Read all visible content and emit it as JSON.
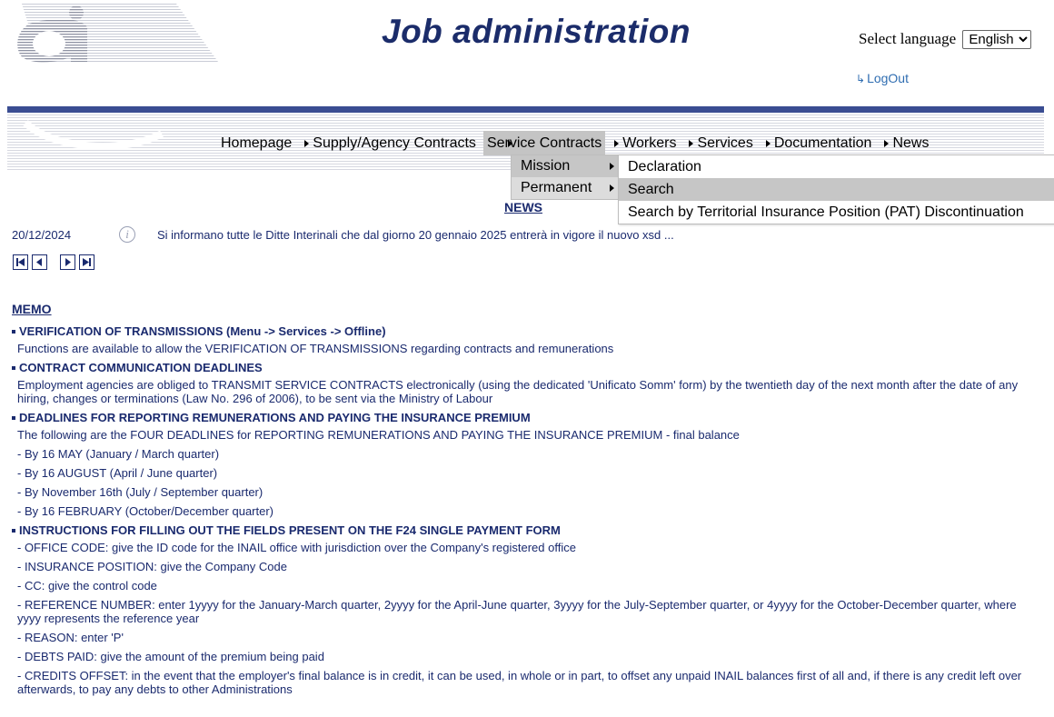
{
  "header": {
    "title": "Job administration",
    "language_label": "Select language",
    "language_selected": "English",
    "logout": "LogOut"
  },
  "menu": {
    "items": [
      {
        "label": "Homepage"
      },
      {
        "label": "Supply/Agency Contracts"
      },
      {
        "label": "Service Contracts"
      },
      {
        "label": "Workers"
      },
      {
        "label": "Services"
      },
      {
        "label": "Documentation"
      },
      {
        "label": "News"
      }
    ],
    "service_contracts_submenu": [
      "Mission",
      "Permanent"
    ],
    "mission_submenu": [
      "Declaration",
      "Search",
      "Search by Territorial Insurance Position (PAT) Discontinuation"
    ]
  },
  "news": {
    "title": "NEWS",
    "date": "20/12/2024",
    "text": "Si informano tutte le Ditte Interinali che dal giorno 20 gennaio 2025 entrerà in vigore il nuovo xsd ..."
  },
  "memo": {
    "title": "MEMO",
    "sections": [
      {
        "heading": "VERIFICATION OF TRANSMISSIONS (Menu -> Services -> Offline)",
        "lines": [
          "Functions are available to allow the VERIFICATION OF TRANSMISSIONS regarding contracts and remunerations"
        ]
      },
      {
        "heading": "CONTRACT COMMUNICATION DEADLINES",
        "lines": [
          "Employment agencies are obliged to TRANSMIT SERVICE CONTRACTS electronically (using the dedicated 'Unificato Somm' form) by the twentieth day of the next month after the date of any hiring, changes or terminations (Law No. 296 of 2006), to be sent via the Ministry of Labour"
        ]
      },
      {
        "heading": "DEADLINES FOR REPORTING REMUNERATIONS AND PAYING THE INSURANCE PREMIUM",
        "lines": [
          "The following are the FOUR DEADLINES for REPORTING REMUNERATIONS AND PAYING THE INSURANCE PREMIUM - final balance",
          "- By 16 MAY (January / March quarter)",
          "- By 16 AUGUST (April / June quarter)",
          "- By November 16th (July / September quarter)",
          "- By 16 FEBRUARY (October/December quarter)"
        ]
      },
      {
        "heading": "INSTRUCTIONS FOR FILLING OUT THE FIELDS PRESENT ON THE F24 SINGLE PAYMENT FORM",
        "lines": [
          "- OFFICE CODE: give the ID code for the INAIL office with jurisdiction over the Company's registered office",
          "- INSURANCE POSITION: give the Company Code",
          "- CC: give the control code",
          "- REFERENCE NUMBER: enter 1yyyy for the January-March quarter, 2yyyy for the April-June quarter, 3yyyy for the July-September quarter, or 4yyyy for the October-December quarter, where yyyy represents the reference year",
          "- REASON: enter 'P'",
          "- DEBTS PAID: give the amount of the premium being paid",
          "- CREDITS OFFSET: in the event that the employer's final balance is in credit, it can be used, in whole or in part, to offset any unpaid INAIL balances first of all and, if there is any credit left over afterwards, to pay any debts to other Administrations"
        ]
      }
    ]
  }
}
